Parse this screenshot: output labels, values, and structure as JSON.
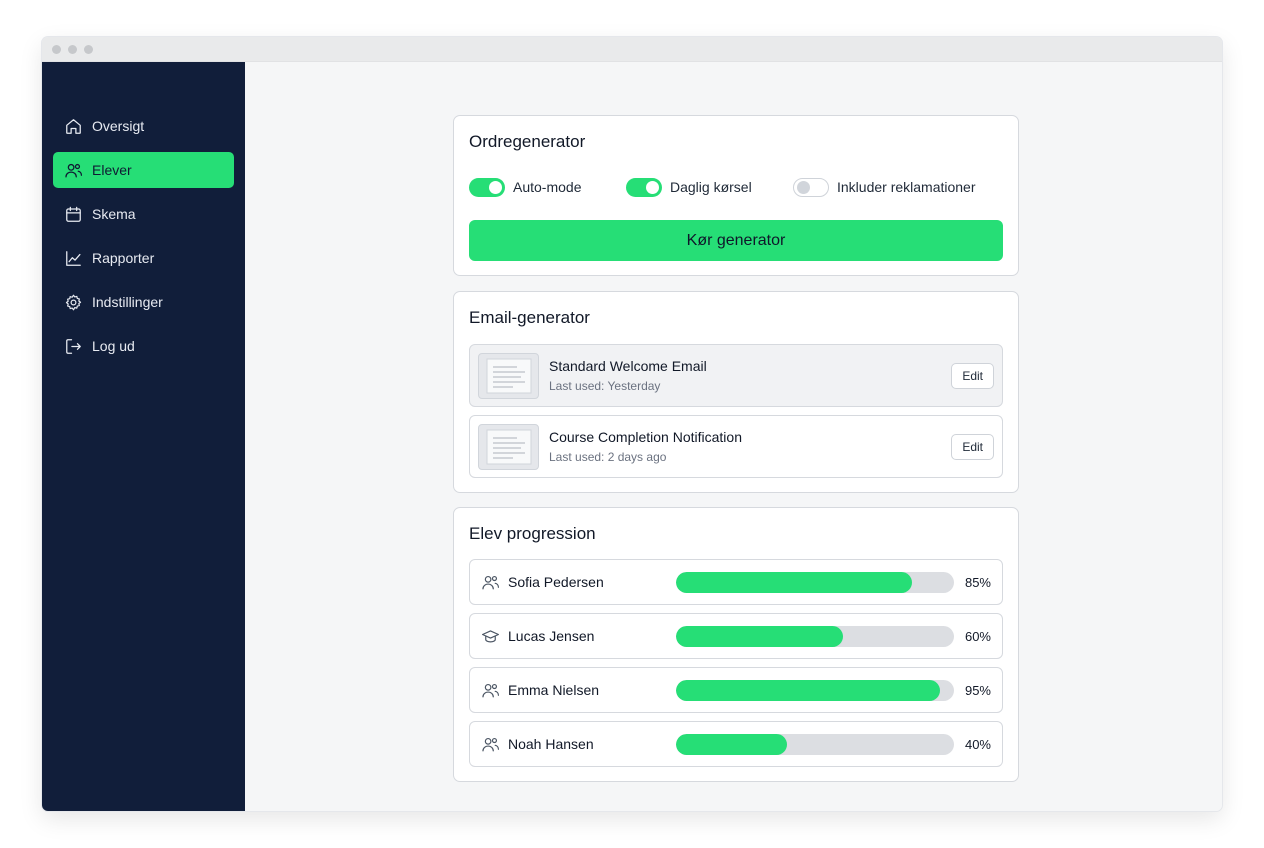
{
  "sidebar": {
    "items": [
      {
        "label": "Oversigt",
        "icon": "home-icon",
        "active": false
      },
      {
        "label": "Elever",
        "icon": "users-icon",
        "active": true
      },
      {
        "label": "Skema",
        "icon": "calendar-icon",
        "active": false
      },
      {
        "label": "Rapporter",
        "icon": "chart-line-icon",
        "active": false
      },
      {
        "label": "Indstillinger",
        "icon": "gear-icon",
        "active": false
      },
      {
        "label": "Log ud",
        "icon": "logout-icon",
        "active": false
      }
    ]
  },
  "order_generator": {
    "title": "Ordregenerator",
    "toggles": [
      {
        "label": "Auto-mode",
        "on": true
      },
      {
        "label": "Daglig kørsel",
        "on": true
      },
      {
        "label": "Inkluder reklamationer",
        "on": false
      }
    ],
    "run_label": "Kør generator"
  },
  "email_generator": {
    "title": "Email-generator",
    "templates": [
      {
        "name": "Standard Welcome Email",
        "meta": "Last used: Yesterday",
        "edit_label": "Edit"
      },
      {
        "name": "Course Completion Notification",
        "meta": "Last used: 2 days ago",
        "edit_label": "Edit"
      }
    ]
  },
  "progression": {
    "title": "Elev progression",
    "students": [
      {
        "name": "Sofia Pedersen",
        "icon": "user-icon",
        "progress": 85,
        "label": "85%"
      },
      {
        "name": "Lucas Jensen",
        "icon": "graduation-cap-icon",
        "progress": 60,
        "label": "60%"
      },
      {
        "name": "Emma Nielsen",
        "icon": "user-icon",
        "progress": 95,
        "label": "95%"
      },
      {
        "name": "Noah Hansen",
        "icon": "user-icon",
        "progress": 40,
        "label": "40%"
      }
    ]
  },
  "colors": {
    "accent": "#26de76",
    "sidebar_bg": "#111e3a",
    "track": "#dcdee2"
  }
}
